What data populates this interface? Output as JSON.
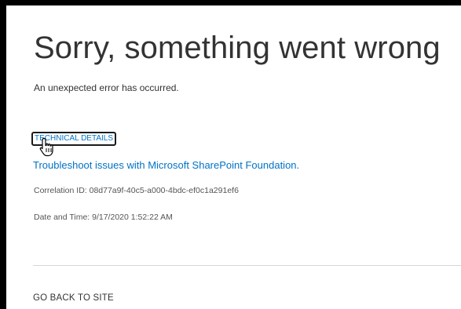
{
  "error": {
    "title": "Sorry, something went wrong",
    "message": "An unexpected error has occurred."
  },
  "links": {
    "technical_details": "TECHNICAL DETAILS",
    "troubleshoot": "Troubleshoot issues with Microsoft SharePoint Foundation.",
    "go_back": "GO BACK TO SITE"
  },
  "details": {
    "correlation": "Correlation ID: 08d77a9f-40c5-a000-4bdc-ef0c1a291ef6",
    "datetime": "Date and Time: 9/17/2020 1:52:22 AM"
  },
  "colors": {
    "link": "#0072c6",
    "text": "#333333",
    "frame": "#000000"
  },
  "icons": {
    "pointer": "hand-pointer-cursor-icon"
  }
}
